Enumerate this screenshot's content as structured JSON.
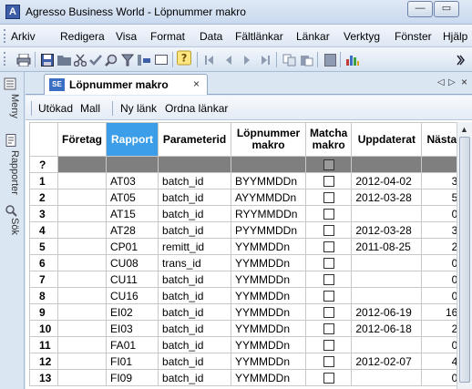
{
  "window": {
    "title": "Agresso Business World - Löpnummer makro",
    "app_icon": "A",
    "minimize_glyph": "—",
    "maximize_glyph": "▭"
  },
  "menu": {
    "items": [
      "Arkiv",
      "Redigera",
      "Visa",
      "Format",
      "Data",
      "Fältlänkar",
      "Länkar",
      "Verktyg",
      "Fönster",
      "Hjälp"
    ]
  },
  "toolbar": {
    "icons": [
      "print-icon",
      "save-icon",
      "open-folder-icon",
      "cut-icon",
      "validate-check-icon",
      "search-icon",
      "filter-icon",
      "insert-row-icon",
      "blank-icon",
      "help-icon",
      "first-record-icon",
      "previous-record-icon",
      "next-record-icon",
      "last-record-icon",
      "copy-icon",
      "paste-icon",
      "blank-page-icon",
      "chart-icon",
      "more-icon"
    ]
  },
  "sidebar": {
    "items": [
      {
        "label": "Meny",
        "icon": "menu-icon"
      },
      {
        "label": "Rapporter",
        "icon": "reports-icon"
      },
      {
        "label": "Sök",
        "icon": "search-icon"
      }
    ]
  },
  "tab": {
    "badge": "SE",
    "label": "Löpnummer makro",
    "close": "×",
    "nav_left": "◁",
    "nav_right": "▷",
    "nav_close": "×"
  },
  "subtoolbar": {
    "expanded": "Utökad",
    "template": "Mall",
    "new_link": "Ny länk",
    "arrange_links": "Ordna länkar"
  },
  "grid": {
    "columns": [
      {
        "label": "Företag",
        "active": false
      },
      {
        "label": "Rapport",
        "active": true
      },
      {
        "label": "Parameterid",
        "active": false
      },
      {
        "label": "Löpnummer makro",
        "active": false
      },
      {
        "label": "Matcha makro",
        "active": false
      },
      {
        "label": "Uppdaterat",
        "active": false
      },
      {
        "label": "Nästa",
        "active": false
      }
    ],
    "new_row_marker": "?",
    "rows": [
      {
        "n": "1",
        "company": "",
        "report": "AT03",
        "param": "batch_id",
        "macro": "BYYMMDDn",
        "match": false,
        "updated": "2012-04-02",
        "next": "3"
      },
      {
        "n": "2",
        "company": "",
        "report": "AT05",
        "param": "batch_id",
        "macro": "AYYMMDDn",
        "match": false,
        "updated": "2012-03-28",
        "next": "5"
      },
      {
        "n": "3",
        "company": "",
        "report": "AT15",
        "param": "batch_id",
        "macro": "RYYMMDDn",
        "match": false,
        "updated": "",
        "next": "0"
      },
      {
        "n": "4",
        "company": "",
        "report": "AT28",
        "param": "batch_id",
        "macro": "PYYMMDDn",
        "match": false,
        "updated": "2012-03-28",
        "next": "3"
      },
      {
        "n": "5",
        "company": "",
        "report": "CP01",
        "param": "remitt_id",
        "macro": "YYMMDDn",
        "match": false,
        "updated": "2011-08-25",
        "next": "2"
      },
      {
        "n": "6",
        "company": "",
        "report": "CU08",
        "param": "trans_id",
        "macro": "YYMMDDn",
        "match": false,
        "updated": "",
        "next": "0"
      },
      {
        "n": "7",
        "company": "",
        "report": "CU11",
        "param": "batch_id",
        "macro": "YYMMDDn",
        "match": false,
        "updated": "",
        "next": "0"
      },
      {
        "n": "8",
        "company": "",
        "report": "CU16",
        "param": "batch_id",
        "macro": "YYMMDDn",
        "match": false,
        "updated": "",
        "next": "0"
      },
      {
        "n": "9",
        "company": "",
        "report": "EI02",
        "param": "batch_id",
        "macro": "YYMMDDn",
        "match": false,
        "updated": "2012-06-19",
        "next": "16"
      },
      {
        "n": "10",
        "company": "",
        "report": "EI03",
        "param": "batch_id",
        "macro": "YYMMDDn",
        "match": false,
        "updated": "2012-06-18",
        "next": "2"
      },
      {
        "n": "11",
        "company": "",
        "report": "FA01",
        "param": "batch_id",
        "macro": "YYMMDDn",
        "match": false,
        "updated": "",
        "next": "0"
      },
      {
        "n": "12",
        "company": "",
        "report": "FI01",
        "param": "batch_id",
        "macro": "YYMMDDn",
        "match": false,
        "updated": "2012-02-07",
        "next": "4"
      },
      {
        "n": "13",
        "company": "",
        "report": "FI09",
        "param": "batch_id",
        "macro": "YYMMDDn",
        "match": false,
        "updated": "",
        "next": "0"
      }
    ]
  },
  "colors": {
    "active_header": "#3c9ee8",
    "new_row": "#7f7f7f",
    "chrome": "#dbe6f3"
  }
}
